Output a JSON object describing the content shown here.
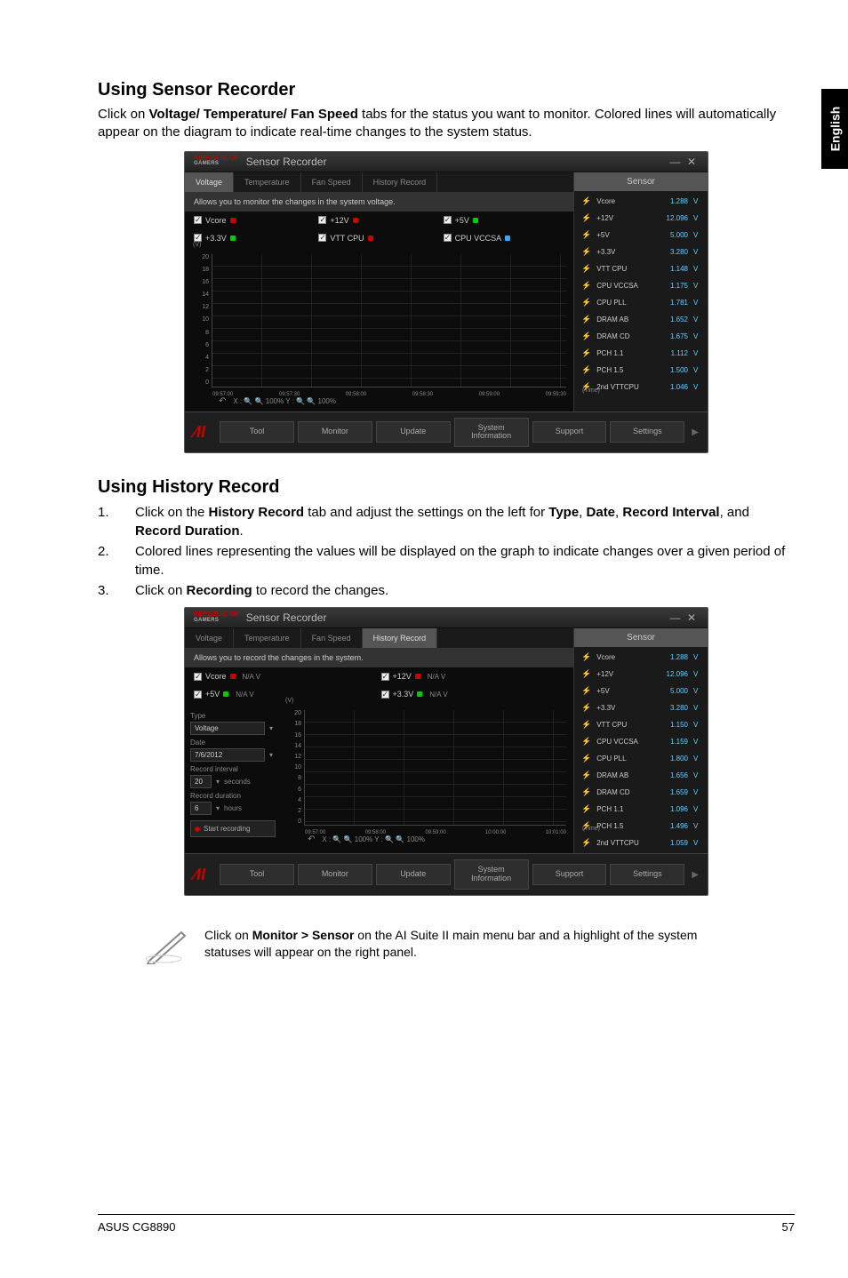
{
  "sideTab": "English",
  "section1": {
    "title": "Using Sensor Recorder",
    "body_pre": "Click on ",
    "body_bold": "Voltage/ Temperature/ Fan Speed",
    "body_post": " tabs for the status you want to monitor. Colored lines will automatically appear on the diagram to indicate real-time changes to the system status."
  },
  "section2": {
    "title": "Using History Record",
    "items": [
      {
        "num": "1.",
        "pre": "Click on the ",
        "b1": "History Record",
        "mid1": " tab and adjust the settings on the left for ",
        "b2": "Type",
        "mid2": ", ",
        "b3": "Date",
        "mid3": ", ",
        "b4": "Record Interval",
        "mid4": ", and ",
        "b5": "Record Duration",
        "post": "."
      },
      {
        "num": "2.",
        "text": "Colored lines representing the values will be displayed on the graph to indicate changes over a given period of time."
      },
      {
        "num": "3.",
        "pre": "Click on ",
        "b1": "Recording",
        "post": " to record the changes."
      }
    ]
  },
  "note": {
    "pre": "Click on ",
    "bold": "Monitor > Sensor",
    "post": " on the AI Suite II main menu bar and a highlight of the system statuses will appear on the right panel."
  },
  "footer": {
    "left": "ASUS CG8890",
    "right": "57"
  },
  "app": {
    "brand": "REPUBLIC OF",
    "brand2": "GAMERS",
    "title": "Sensor Recorder",
    "win": {
      "min": "—",
      "close": "✕"
    },
    "tabs": [
      "Voltage",
      "Temperature",
      "Fan Speed",
      "History Record"
    ],
    "hint1": "Allows you to monitor the changes in the system voltage.",
    "hint2": "Allows you to record the changes in the system.",
    "toggles1": [
      "Vcore",
      "+12V",
      "+5V",
      "+3.3V",
      "VTT CPU",
      "CPU VCCSA"
    ],
    "toggles2": [
      {
        "label": "Vcore",
        "val": "N/A",
        "unit": "V"
      },
      {
        "label": "+12V",
        "val": "N/A",
        "unit": "V"
      },
      {
        "label": "+5V",
        "val": "N/A",
        "unit": "V"
      },
      {
        "label": "+3.3V",
        "val": "N/A",
        "unit": "V"
      }
    ],
    "bottom": [
      "Tool",
      "Monitor",
      "Update",
      "System\nInformation",
      "Support",
      "Settings"
    ],
    "sensorHeader": "Sensor",
    "sensors1": [
      {
        "n": "Vcore",
        "v": "1.288",
        "u": "V"
      },
      {
        "n": "+12V",
        "v": "12.096",
        "u": "V"
      },
      {
        "n": "+5V",
        "v": "5.000",
        "u": "V"
      },
      {
        "n": "+3.3V",
        "v": "3.280",
        "u": "V"
      },
      {
        "n": "VTT CPU",
        "v": "1.148",
        "u": "V"
      },
      {
        "n": "CPU VCCSA",
        "v": "1.175",
        "u": "V"
      },
      {
        "n": "CPU PLL",
        "v": "1.781",
        "u": "V"
      },
      {
        "n": "DRAM AB",
        "v": "1.652",
        "u": "V"
      },
      {
        "n": "DRAM CD",
        "v": "1.675",
        "u": "V"
      },
      {
        "n": "PCH 1.1",
        "v": "1.112",
        "u": "V"
      },
      {
        "n": "PCH 1.5",
        "v": "1.500",
        "u": "V"
      },
      {
        "n": "2nd VTTCPU",
        "v": "1.046",
        "u": "V"
      }
    ],
    "sensors2": [
      {
        "n": "Vcore",
        "v": "1.288",
        "u": "V"
      },
      {
        "n": "+12V",
        "v": "12.096",
        "u": "V"
      },
      {
        "n": "+5V",
        "v": "5.000",
        "u": "V"
      },
      {
        "n": "+3.3V",
        "v": "3.280",
        "u": "V"
      },
      {
        "n": "VTT CPU",
        "v": "1.150",
        "u": "V"
      },
      {
        "n": "CPU VCCSA",
        "v": "1.159",
        "u": "V"
      },
      {
        "n": "CPU PLL",
        "v": "1.800",
        "u": "V"
      },
      {
        "n": "DRAM AB",
        "v": "1.656",
        "u": "V"
      },
      {
        "n": "DRAM CD",
        "v": "1.659",
        "u": "V"
      },
      {
        "n": "PCH 1.1",
        "v": "1.096",
        "u": "V"
      },
      {
        "n": "PCH 1.5",
        "v": "1.496",
        "u": "V"
      },
      {
        "n": "2nd VTTCPU",
        "v": "1.059",
        "u": "V"
      }
    ],
    "settings": {
      "typeLabel": "Type",
      "typeVal": "Voltage",
      "dateLabel": "Date",
      "dateVal": "7/6/2012",
      "intervalLabel": "Record interval",
      "intervalVal": "20",
      "intervalUnit": "seconds",
      "durationLabel": "Record duration",
      "durationVal": "6",
      "durationUnit": "hours",
      "startLabel": "Start recording"
    }
  },
  "chart_data": [
    {
      "type": "line",
      "title": "",
      "ylabel": "(V)",
      "xlabel": "(Time)",
      "ylim": [
        0,
        20
      ],
      "yticks": [
        0,
        2,
        4,
        6,
        8,
        10,
        12,
        14,
        16,
        18,
        20
      ],
      "xticks": [
        "09:57:00",
        "09:57:30",
        "09:58:00",
        "09:58:30",
        "09:59:00",
        "09:59:30"
      ],
      "controls": "X : 🔍 🔍 100%   Y : 🔍 🔍 100%",
      "series": []
    },
    {
      "type": "line",
      "title": "",
      "ylabel": "(V)",
      "xlabel": "(Time)",
      "ylim": [
        0,
        20
      ],
      "yticks": [
        0,
        2,
        4,
        6,
        8,
        10,
        12,
        14,
        16,
        18,
        20
      ],
      "xticks": [
        "09:57:00",
        "09:58:00",
        "09:59:00",
        "10:00:00",
        "10:01:00"
      ],
      "controls": "X : 🔍 🔍 100%   Y : 🔍 🔍 100%",
      "series": []
    }
  ]
}
